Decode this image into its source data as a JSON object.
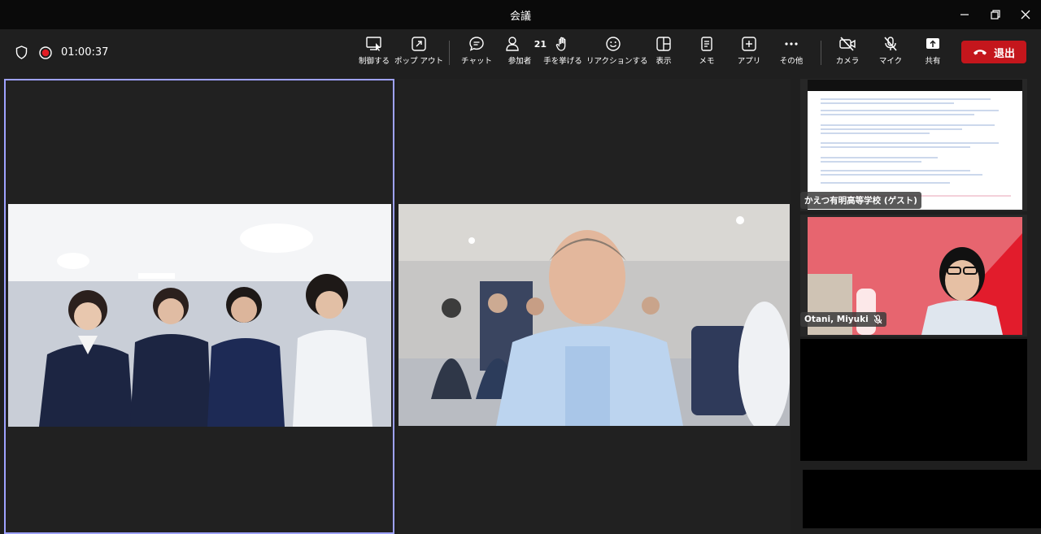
{
  "window": {
    "title": "会議"
  },
  "toolbar": {
    "timer": "01:00:37",
    "participant_count": "21",
    "buttons": [
      {
        "label": "制御する",
        "icon": "control-icon"
      },
      {
        "label": "ポップ アウト",
        "icon": "popout-icon"
      },
      {
        "label": "チャット",
        "icon": "chat-icon"
      },
      {
        "label": "参加者",
        "icon": "people-icon"
      },
      {
        "label": "手を挙げる",
        "icon": "raise-hand-icon"
      },
      {
        "label": "リアクションする",
        "icon": "reaction-icon"
      },
      {
        "label": "表示",
        "icon": "view-icon"
      },
      {
        "label": "メモ",
        "icon": "notes-icon"
      },
      {
        "label": "アプリ",
        "icon": "apps-icon"
      },
      {
        "label": "その他",
        "icon": "more-icon"
      },
      {
        "label": "カメラ",
        "icon": "camera-off-icon"
      },
      {
        "label": "マイク",
        "icon": "mic-off-icon"
      },
      {
        "label": "共有",
        "icon": "share-icon"
      }
    ],
    "leave_label": "退出"
  },
  "sidebar": {
    "tiles": [
      {
        "name": "かえつ有明高等学校 (ゲスト)"
      },
      {
        "name": "Otani, Miyuki"
      }
    ]
  },
  "colors": {
    "accent": "#9ea2ff",
    "leave": "#c4161c",
    "background": "#1f1f1f"
  }
}
